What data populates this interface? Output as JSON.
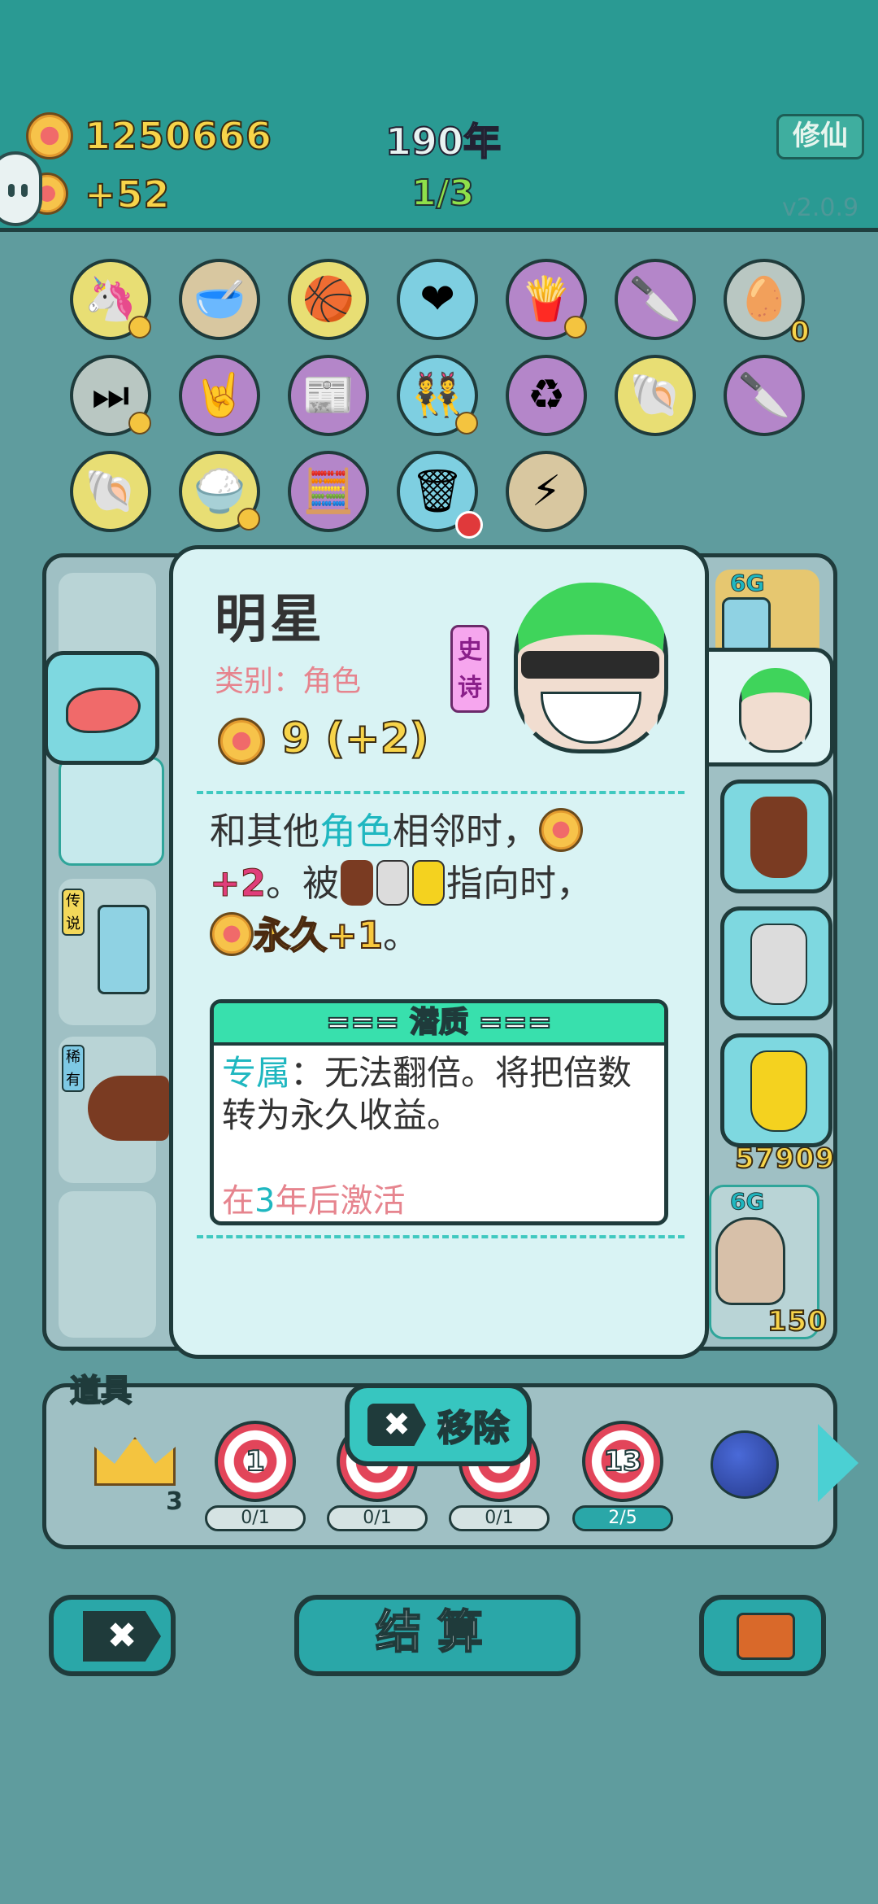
{
  "header": {
    "coins": "1250666",
    "income": "+52",
    "year": "190年",
    "progress": "1/3",
    "xiuxian_button": "修仙",
    "version": "v2.0.9"
  },
  "grid": {
    "row1": [
      "unicorn-icon",
      "pet-bowl-icon",
      "basketballs-icon",
      "heart-potion-icon",
      "fries-icon",
      "cleaver-icon",
      "egg-carton-icon"
    ],
    "row1_counter": "0",
    "row2": [
      "skip-icon",
      "rock-hand-icon",
      "time-magazine-icon",
      "twins-icon",
      "recycle-icon",
      "shell-icon",
      "cleaver-icon"
    ],
    "row3": [
      "shell-icon",
      "rice-bowl-icon",
      "math-genius-icon",
      "garbage-bag-icon",
      "lightning-icon"
    ]
  },
  "card": {
    "title": "明星",
    "category": "类别：角色",
    "value": "9 (+2)",
    "rarity": "史诗",
    "desc_part1": "和其他",
    "desc_role": "角色",
    "desc_part2": "相邻时，",
    "desc_plus2": "+2",
    "desc_part3": "。被",
    "desc_part4": "指向时，",
    "desc_perm": "永久+1",
    "desc_end": "。",
    "potential_title": "=== 潜质 ===",
    "potential_label": "专属",
    "potential_text": "：无法翻倍。将把倍数转为永久收益。",
    "activate_prefix": "在",
    "activate_num": "3",
    "activate_suffix": "年后激活"
  },
  "slots": {
    "tag_6g": "6G",
    "tag_6g_2": "6G",
    "score_1": "57909",
    "score_2": "150",
    "side_label_1": "传说",
    "side_label_2": "稀有"
  },
  "items": {
    "label": "道具",
    "crown_count": "3",
    "targets": [
      {
        "num": "1",
        "progress": "0/1"
      },
      {
        "num": "",
        "progress": "0/1"
      },
      {
        "num": "",
        "progress": "0/1"
      },
      {
        "num": "13",
        "progress": "2/5"
      }
    ],
    "remove_button": "移除"
  },
  "footer": {
    "settle_button": "结算"
  }
}
